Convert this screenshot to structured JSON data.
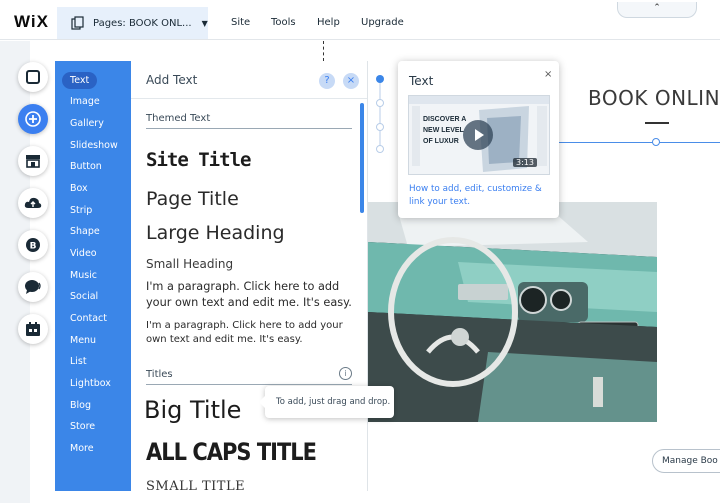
{
  "topbar": {
    "logo": "WiX",
    "pages_label": "Pages: BOOK ONL...",
    "menu": [
      "Site",
      "Tools",
      "Help",
      "Upgrade"
    ]
  },
  "tools": [
    "layout-icon",
    "add-icon",
    "store-icon",
    "upload-icon",
    "blog-icon",
    "chat-icon",
    "calendar-icon"
  ],
  "categories": [
    "Text",
    "Image",
    "Gallery",
    "Slideshow",
    "Button",
    "Box",
    "Strip",
    "Shape",
    "Video",
    "Music",
    "Social",
    "Contact",
    "Menu",
    "List",
    "Lightbox",
    "Blog",
    "Store",
    "More"
  ],
  "panel": {
    "title": "Add Text",
    "help": "?",
    "close": "×",
    "themed_label": "Themed Text",
    "site_title": "Site Title",
    "page_title": "Page Title",
    "large_heading": "Large Heading",
    "small_heading": "Small Heading",
    "paragraph_1": "I'm a paragraph. Click here to add your own text and edit me. It's easy.",
    "paragraph_2": "I'm a paragraph. Click here to add your own text and edit me. It's easy.",
    "titles_label": "Titles",
    "info": "i",
    "big_title": "Big Title",
    "all_caps": "ALL CAPS TITLE",
    "small_title": "SMALL TITLE"
  },
  "drag_tip": "To add, just drag and drop.",
  "video_popover": {
    "title": "Text",
    "close": "×",
    "thumb_text": [
      "DISCOVER A",
      "NEW LEVEL",
      "OF LUXUR"
    ],
    "duration": "3:13",
    "description": "How to add, edit, customize & link your text."
  },
  "page": {
    "heading": "BOOK ONLIN",
    "manage_button": "Manage Boo"
  },
  "colors": {
    "accent": "#3b86e8",
    "selected": "#2a62c4"
  }
}
